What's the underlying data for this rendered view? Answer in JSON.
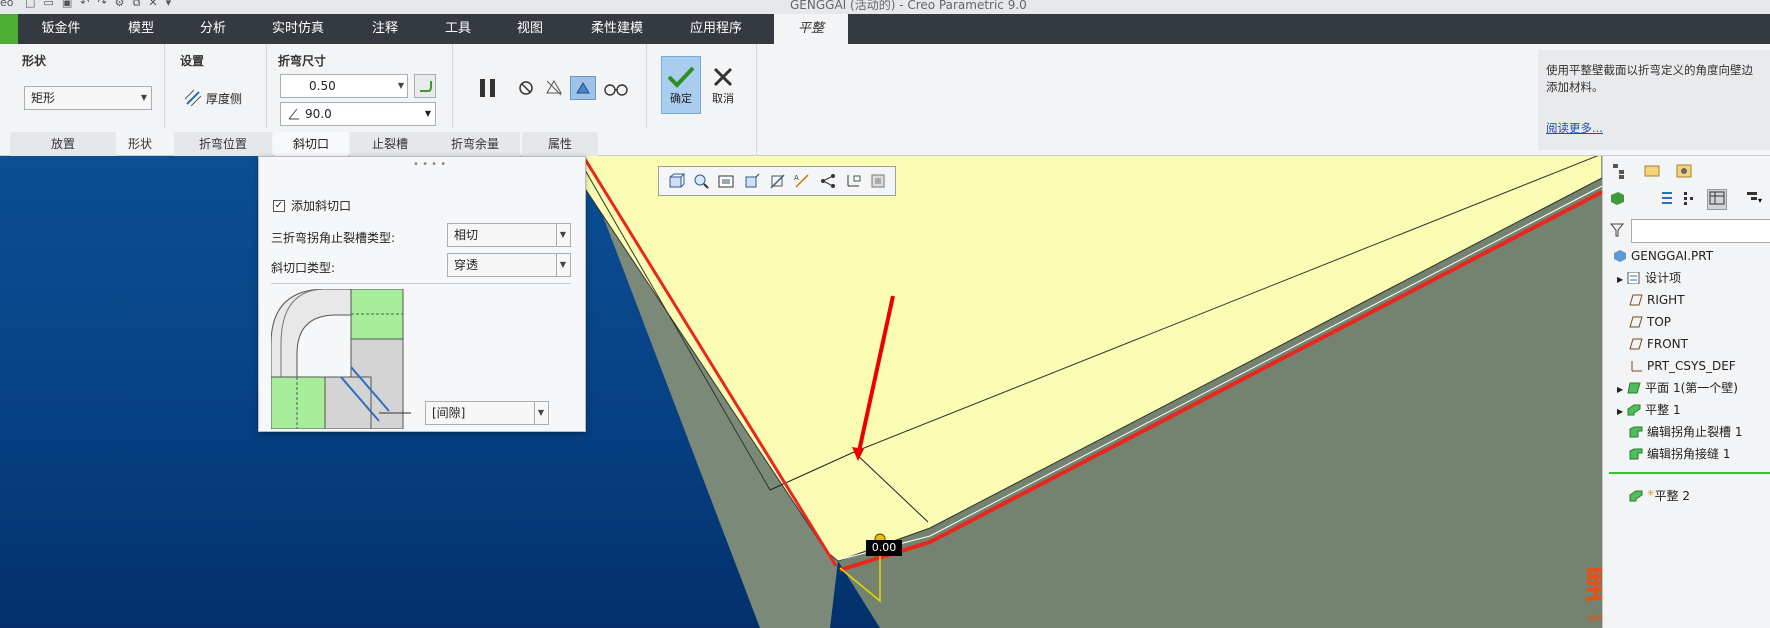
{
  "window": {
    "title": "GENGGAI (活动的) - Creo Parametric 9.0",
    "left_text": "eo"
  },
  "ribbon_tabs": [
    "钣金件",
    "模型",
    "分析",
    "实时仿真",
    "注释",
    "工具",
    "视图",
    "柔性建模",
    "应用程序",
    "平整"
  ],
  "ribbon": {
    "shape_group": {
      "label": "形状",
      "value": "矩形"
    },
    "settings_group": {
      "label": "设置",
      "thickness_label": "厚度侧"
    },
    "bend_group": {
      "label": "折弯尺寸",
      "radius_value": "0.50",
      "angle_value": "90.0"
    },
    "ok_label": "确定",
    "cancel_label": "取消"
  },
  "subtabs": [
    "放置",
    "形状",
    "折弯位置",
    "斜切口",
    "止裂槽",
    "折弯余量",
    "属性"
  ],
  "tooltip": {
    "text": "使用平整壁截面以折弯定义的角度向壁边添加材料。",
    "link": "阅读更多..."
  },
  "miter_panel": {
    "add_miter_label": "添加斜切口",
    "add_miter_checked": true,
    "relief_type_label": "三折弯拐角止裂槽类型:",
    "relief_type_value": "相切",
    "miter_type_label": "斜切口类型:",
    "miter_type_value": "穿透",
    "gap_value": "[间隙]"
  },
  "model_tree": {
    "root": "GENGGAI.PRT",
    "items": [
      "设计项",
      "RIGHT",
      "TOP",
      "FRONT",
      "PRT_CSYS_DEF",
      "平面 1(第一个壁)",
      "平整 1",
      "编辑拐角止裂槽 1",
      "编辑拐角接缝 1"
    ],
    "active_item": "平整 2"
  },
  "viewport": {
    "dim_label": "0.00"
  },
  "watermark": {
    "text": "野火论坛",
    "url": "www.proewildfire.cn"
  },
  "colors": {
    "accent_green": "#4cae32",
    "tab_bar": "#343a3f",
    "viewport_blue": "#0b4f93",
    "plate_yellow": "#fafcb4",
    "highlight_red": "#e8281e",
    "panel_green": "#a6ee9a"
  }
}
